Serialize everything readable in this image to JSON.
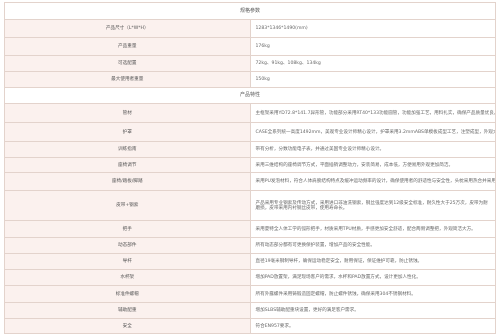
{
  "specs": {
    "title": "规格参数",
    "rows": [
      {
        "label": "产品尺寸（L*W*H）",
        "value": "1283*1346*1490(mm)"
      },
      {
        "label": "产品重量",
        "value": "176kg"
      },
      {
        "label": "可选配置",
        "value": "72kg、91kg、108kg、134kg"
      },
      {
        "label": "最大使用者重量",
        "value": "150kg"
      }
    ]
  },
  "features": {
    "title": "产品特性",
    "rows": [
      {
        "label": "管材",
        "value": "主框架采用YD72.8*141.7异形管，功能部分采用RT40*133功能圆管，功能加强工艺，用料扎实，确保产品质量优良。"
      },
      {
        "label": "护罩",
        "value": "CASE全系列统一高度1492mm，美观专业设计师精心设计，护罩采用3.2mmABS单模板成型工艺，注塑成型，外观大方，耐用不易变形。"
      },
      {
        "label": "训练指南",
        "value": "带有分析，分数功能电子表，并通过美国专业设计师精心设计。"
      },
      {
        "label": "座椅调节",
        "value": "采用三维结构的座椅调节方式，平面插销调整动力，安装简易，成本低，方便易用外观更加简洁。"
      },
      {
        "label": "座椅/踏板/脚踏",
        "value": "采用PU发泡材料，符合人体肩膀结构特点及缓冲运动频率的设计，确保使用者的舒适性与安全性，头枕采用热合并采用部分功能设置等。"
      },
      {
        "label": "皮带+钢索",
        "value": "产品采用专业钢索及传动方式，采用进口非油洗钢索，钢丝强度达到12级安全标准，耐久性大于25万次，皮带为耐磨损，皮带采用内衬钢丝皮带，使用寿命长。"
      },
      {
        "label": "把手",
        "value": "采用夏特全人体工学的弧形把手，材质采用TPU材质，手感更加安全舒适，配合两侧调整把，外观简洁大方。"
      },
      {
        "label": "动态部件",
        "value": "所有动态部分都有可更换保护装置，增加产品的安全性能。"
      },
      {
        "label": "导杆",
        "value": "直径19毫米钢制导杆，确保运动稳定安全，耐用保证，保证维护可靠，防止锈蚀。"
      },
      {
        "label": "水杯架",
        "value": "增加PAD放置架，满足现场客户的需求，水杯和PAD放置方式，设计更加人性化。"
      },
      {
        "label": "标准件螺帽",
        "value": "所有外露螺件采用铸锻造固定螺帽，防止螺件锈蚀，确保采用304不锈钢材料。"
      },
      {
        "label": "辅助配重",
        "value": "增加SLBS辅助配重块设置，更好的满足客户需求。"
      },
      {
        "label": "安全",
        "value": "符合EN957要求。"
      }
    ]
  }
}
